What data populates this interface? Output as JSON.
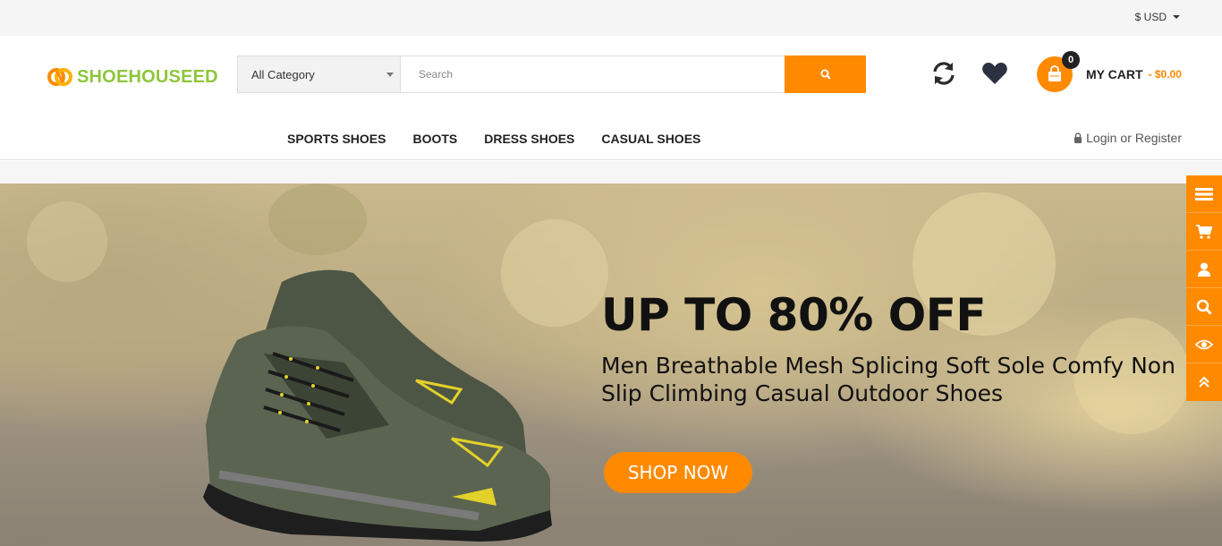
{
  "topbar": {
    "currency": "$ USD"
  },
  "header": {
    "logo_text": "SHOEHOUSEED",
    "search": {
      "category": "All Category",
      "placeholder": "Search"
    },
    "cart": {
      "count": "0",
      "label": "MY CART",
      "total": "- $0.00"
    }
  },
  "nav": {
    "items": [
      {
        "label": "SPORTS SHOES"
      },
      {
        "label": "BOOTS"
      },
      {
        "label": "DRESS SHOES"
      },
      {
        "label": "CASUAL SHOES"
      }
    ],
    "login": "Login",
    "or": "or",
    "register": "Register"
  },
  "banner": {
    "headline": "UP TO 80% OFF",
    "subhead": "Men Breathable Mesh Splicing Soft Sole Comfy Non Slip Climbing Casual Outdoor Shoes",
    "button": "SHOP NOW"
  },
  "sidebar": {
    "icons": [
      "menu-icon",
      "cart-icon",
      "user-icon",
      "search-icon",
      "eye-icon",
      "chevron-up-icon"
    ]
  },
  "colors": {
    "accent": "#ff8a00",
    "logo_green": "#8fc63c",
    "dark": "#222222"
  }
}
